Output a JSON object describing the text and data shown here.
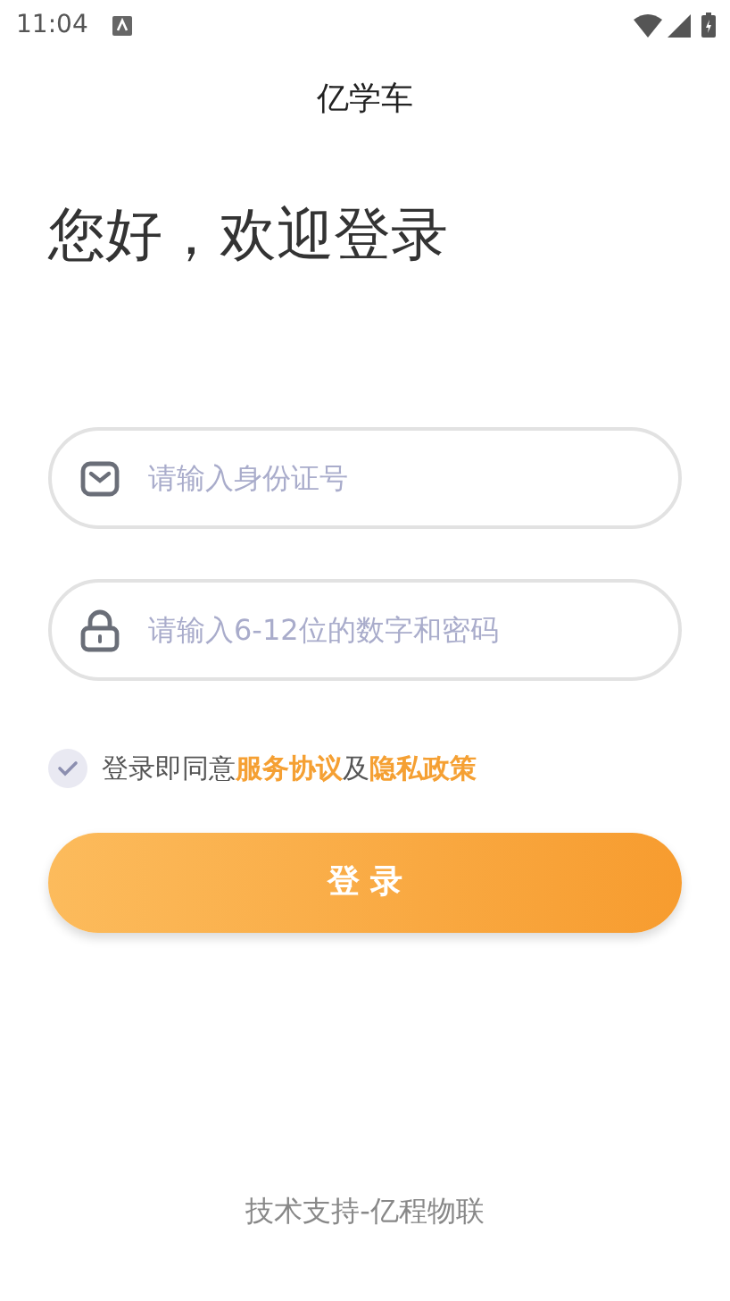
{
  "status_bar": {
    "time": "11:04"
  },
  "app_title": "亿学车",
  "greeting": "您好，欢迎登录",
  "fields": [
    {
      "kind": "id",
      "placeholder": "请输入身份证号"
    },
    {
      "kind": "password",
      "placeholder": "请输入6-12位的数字和密码"
    }
  ],
  "agreement": {
    "checked": true,
    "parts": [
      {
        "kind": "text",
        "text": "登录即同意"
      },
      {
        "kind": "link",
        "text": "服务协议"
      },
      {
        "kind": "text",
        "text": "及"
      },
      {
        "kind": "link",
        "text": "隐私政策"
      }
    ]
  },
  "login_button": "登 录",
  "footer": "技术支持-亿程物联"
}
